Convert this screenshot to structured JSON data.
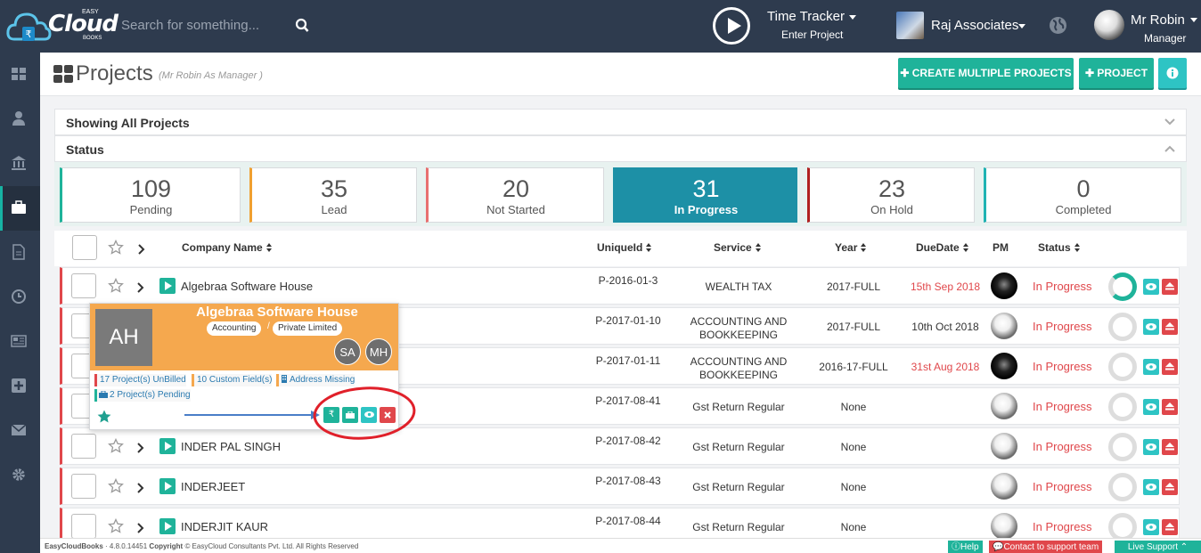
{
  "app": {
    "logo_word": "Cloud",
    "logo_easy": "EASY",
    "logo_books": "BOOKS"
  },
  "search": {
    "placeholder": "Search for something..."
  },
  "timetracker": {
    "title": "Time Tracker",
    "sub": "Enter Project"
  },
  "org": {
    "name": "Raj Associates"
  },
  "user": {
    "name": "Mr Robin",
    "role": "Manager"
  },
  "page": {
    "title": "Projects",
    "subtitle": "(Mr Robin As Manager )",
    "create_multiple": "CREATE MULTIPLE PROJECTS",
    "project": "PROJECT"
  },
  "panels": {
    "showing": "Showing All Projects",
    "status": "Status"
  },
  "status_cards": [
    {
      "count": "109",
      "label": "Pending",
      "color": "#1fb39a"
    },
    {
      "count": "35",
      "label": "Lead",
      "color": "#f0a030"
    },
    {
      "count": "20",
      "label": "Not Started",
      "color": "#e87070"
    },
    {
      "count": "31",
      "label": "In Progress",
      "color": "#1d90a6"
    },
    {
      "count": "23",
      "label": "On Hold",
      "color": "#b02020"
    },
    {
      "count": "0",
      "label": "Completed",
      "color": "#1fb3b3"
    }
  ],
  "columns": {
    "company": "Company Name",
    "uid": "UniqueId",
    "service": "Service",
    "year": "Year",
    "due": "DueDate",
    "pm": "PM",
    "status": "Status"
  },
  "rows": [
    {
      "company": "Algebraa Software House",
      "uid": "P-2016-01-3",
      "service": "WEALTH TAX",
      "year": "2017-FULL",
      "due": "15th Sep 2018",
      "status": "In Progress"
    },
    {
      "company": "",
      "uid": "P-2017-01-10",
      "service": "ACCOUNTING AND BOOKKEEPING",
      "year": "2017-FULL",
      "due": "10th Oct 2018",
      "status": "In Progress"
    },
    {
      "company": "",
      "uid": "P-2017-01-11",
      "service": "ACCOUNTING AND BOOKKEEPING",
      "year": "2016-17-FULL",
      "due": "31st Aug 2018",
      "status": "In Progress"
    },
    {
      "company": "",
      "uid": "P-2017-08-41",
      "service": "Gst Return Regular",
      "year": "None",
      "due": "",
      "status": "In Progress"
    },
    {
      "company": "INDER PAL SINGH",
      "uid": "P-2017-08-42",
      "service": "Gst Return Regular",
      "year": "None",
      "due": "",
      "status": "In Progress"
    },
    {
      "company": "INDERJEET",
      "uid": "P-2017-08-43",
      "service": "Gst Return Regular",
      "year": "None",
      "due": "",
      "status": "In Progress"
    },
    {
      "company": "INDERJIT KAUR",
      "uid": "P-2017-08-44",
      "service": "Gst Return Regular",
      "year": "None",
      "due": "",
      "status": "In Progress"
    }
  ],
  "popup": {
    "initials": "AH",
    "name": "Algebraa Software House",
    "tag1": "Accounting",
    "tag2": "Private Limited",
    "sep": "/",
    "member1": "SA",
    "member2": "MH",
    "unbilled": "17 Project(s) UnBilled",
    "custom": "10 Custom Field(s)",
    "address": "Address Missing",
    "pending": "2 Project(s) Pending",
    "rupee": "₹"
  },
  "footer": {
    "app": "EasyCloudBooks",
    "version": "· 4.8.0.14451",
    "copy_label": "Copyright",
    "copy": "© EasyCloud Consultants Pvt. Ltd. All Rights Reserved",
    "help": "Help",
    "contact": "Contact to support team",
    "live": "Live Support"
  }
}
